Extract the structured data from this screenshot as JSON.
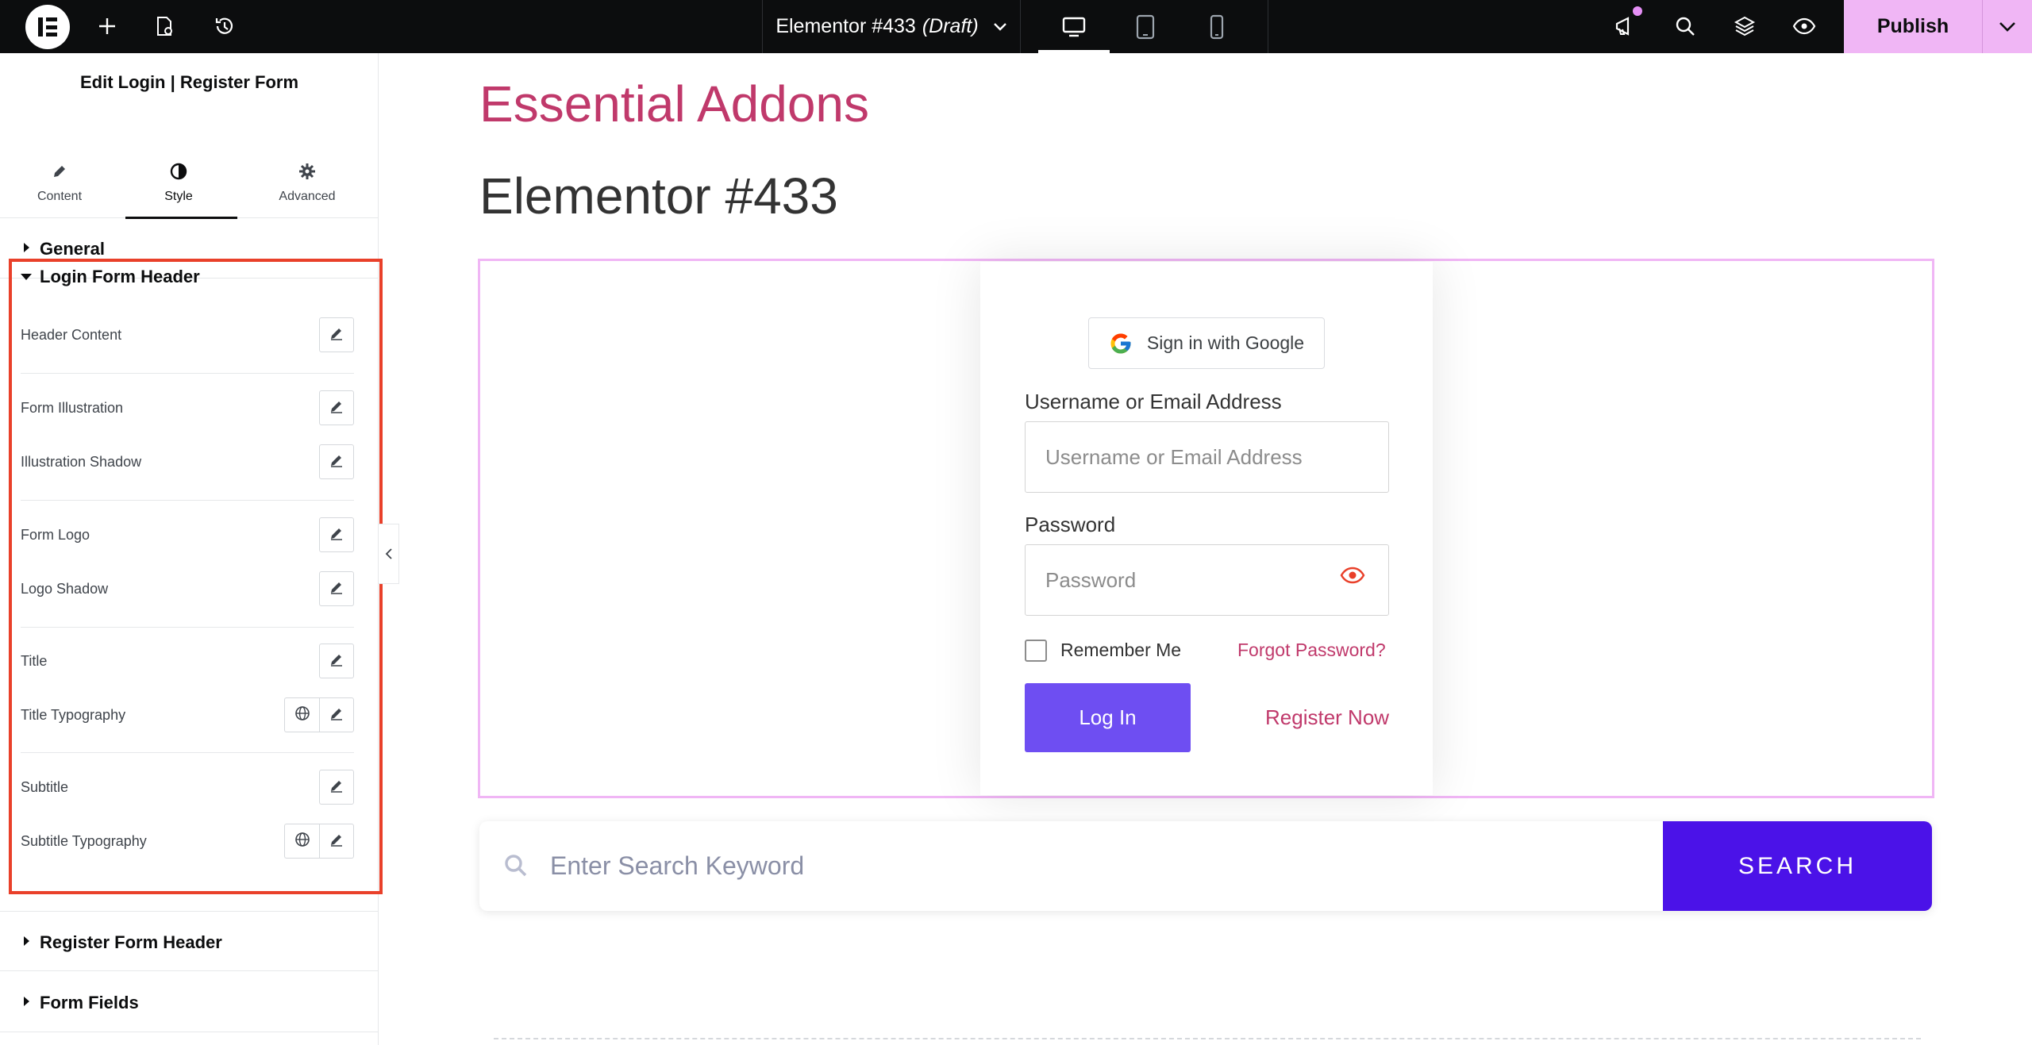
{
  "topbar": {
    "doc_title": "Elementor #433",
    "doc_status": "(Draft)",
    "publish_label": "Publish",
    "icons": [
      "elementor-logo-icon",
      "add-icon",
      "page-settings-icon",
      "history-icon",
      "chevron-down-icon",
      "desktop-icon",
      "tablet-icon",
      "mobile-icon",
      "notifications-icon",
      "search-icon",
      "structure-icon",
      "preview-eye-icon",
      "chevron-down-icon"
    ]
  },
  "panel": {
    "title": "Edit Login | Register Form",
    "tabs": [
      {
        "label": "Content",
        "icon": "pencil-icon"
      },
      {
        "label": "Style",
        "icon": "contrast-icon",
        "active": true
      },
      {
        "label": "Advanced",
        "icon": "gear-icon"
      }
    ],
    "sections": {
      "general": "General",
      "open": "Login Form Header",
      "register_header": "Register Form Header",
      "form_fields": "Form Fields"
    },
    "controls": [
      "Header Content",
      "Form Illustration",
      "Illustration Shadow",
      "Form Logo",
      "Logo Shadow",
      "Title",
      "Title Typography",
      "Subtitle",
      "Subtitle Typography"
    ]
  },
  "canvas": {
    "site_title": "Essential Addons",
    "page_title": "Elementor #433",
    "form": {
      "google_button": "Sign in with Google",
      "username_label": "Username or Email Address",
      "username_placeholder": "Username or Email Address",
      "password_label": "Password",
      "password_placeholder": "Password",
      "remember_label": "Remember Me",
      "forgot_link": "Forgot Password?",
      "login_button": "Log In",
      "register_link": "Register Now"
    },
    "search": {
      "placeholder": "Enter Search Keyword",
      "button": "SEARCH"
    }
  },
  "colors": {
    "topbar_bg": "#0c0d0e",
    "publish_bg": "#f0b6f5",
    "highlight_border": "#e9402a",
    "accent_pink": "#c0396b",
    "login_button": "#6e4ef2",
    "search_button": "#4b12e8"
  }
}
